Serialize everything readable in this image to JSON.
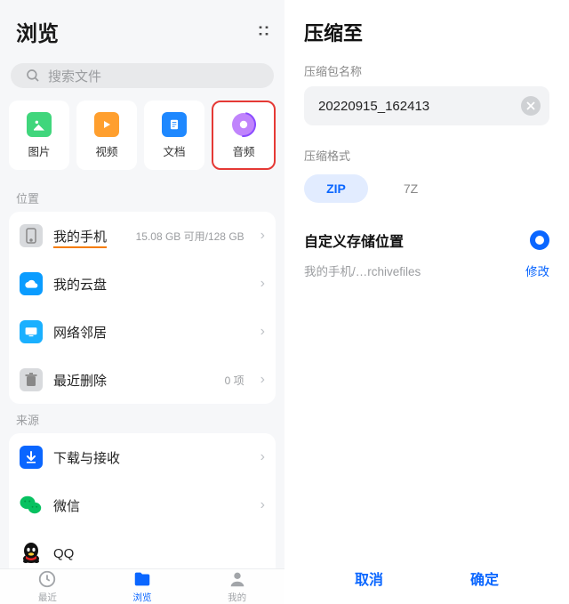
{
  "left": {
    "title": "浏览",
    "search_placeholder": "搜索文件",
    "categories": [
      {
        "label": "图片"
      },
      {
        "label": "视频"
      },
      {
        "label": "文档"
      },
      {
        "label": "音频"
      }
    ],
    "sections": {
      "location": "位置",
      "source": "来源"
    },
    "location_items": {
      "phone": {
        "label": "我的手机",
        "sub": "15.08 GB 可用/128 GB"
      },
      "cloud": {
        "label": "我的云盘"
      },
      "network": {
        "label": "网络邻居"
      },
      "recent_delete": {
        "label": "最近删除",
        "sub": "0 项"
      }
    },
    "source_items": {
      "download": {
        "label": "下载与接收"
      },
      "wechat": {
        "label": "微信"
      },
      "qq": {
        "label": "QQ"
      }
    },
    "nav": {
      "recent": "最近",
      "browse": "浏览",
      "mine": "我的"
    }
  },
  "right": {
    "title": "压缩至",
    "name_label": "压缩包名称",
    "name_value": "20220915_162413",
    "format_label": "压缩格式",
    "format_zip": "ZIP",
    "format_7z": "7Z",
    "custom_storage": "自定义存储位置",
    "path": "我的手机/…rchivefiles",
    "modify": "修改",
    "cancel": "取消",
    "confirm": "确定"
  }
}
